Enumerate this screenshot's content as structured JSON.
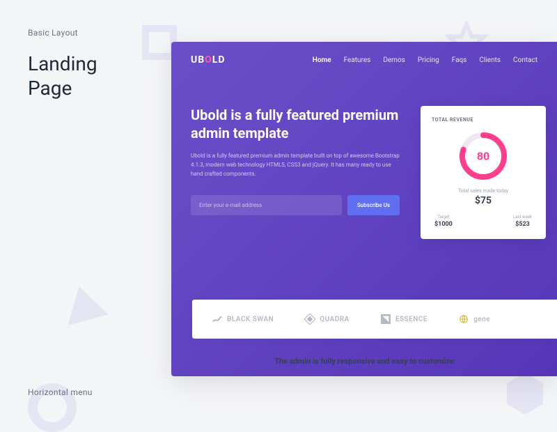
{
  "meta": {
    "category": "Basic Layout",
    "title_line1": "Landing",
    "title_line2": "Page",
    "footer_label": "Horizontal menu"
  },
  "site": {
    "logo_part1": "UB",
    "logo_part2": "O",
    "logo_part3": "LD",
    "nav": [
      "Home",
      "Features",
      "Demos",
      "Pricing",
      "Faqs",
      "Clients",
      "Contact"
    ],
    "active_nav_index": 0,
    "hero": {
      "title": "Ubold is a fully featured premium admin template",
      "subtitle": "Ubold is a fully featured premium admin template built on top of awesome Bootstrap 4.1.3, modern web technology HTML5, CSS3 and jQuery. It has many ready to use hand crafted components.",
      "email_placeholder": "Enter your e-mail address",
      "subscribe_label": "Subscribe Us"
    },
    "revenue_card": {
      "title": "TOTAL REVENUE",
      "donut_value": "80",
      "donut_percent": 80,
      "sales_label": "Total sales made today",
      "sales_value": "$75",
      "target_label": "Target",
      "target_value": "$1000",
      "lastweek_label": "Last week",
      "lastweek_value": "$523"
    },
    "clients": [
      "BLACK SWAN",
      "QUADRA",
      "ESSENCE",
      "gene"
    ],
    "tagline": "The admin is fully responsive and easy to customize"
  }
}
